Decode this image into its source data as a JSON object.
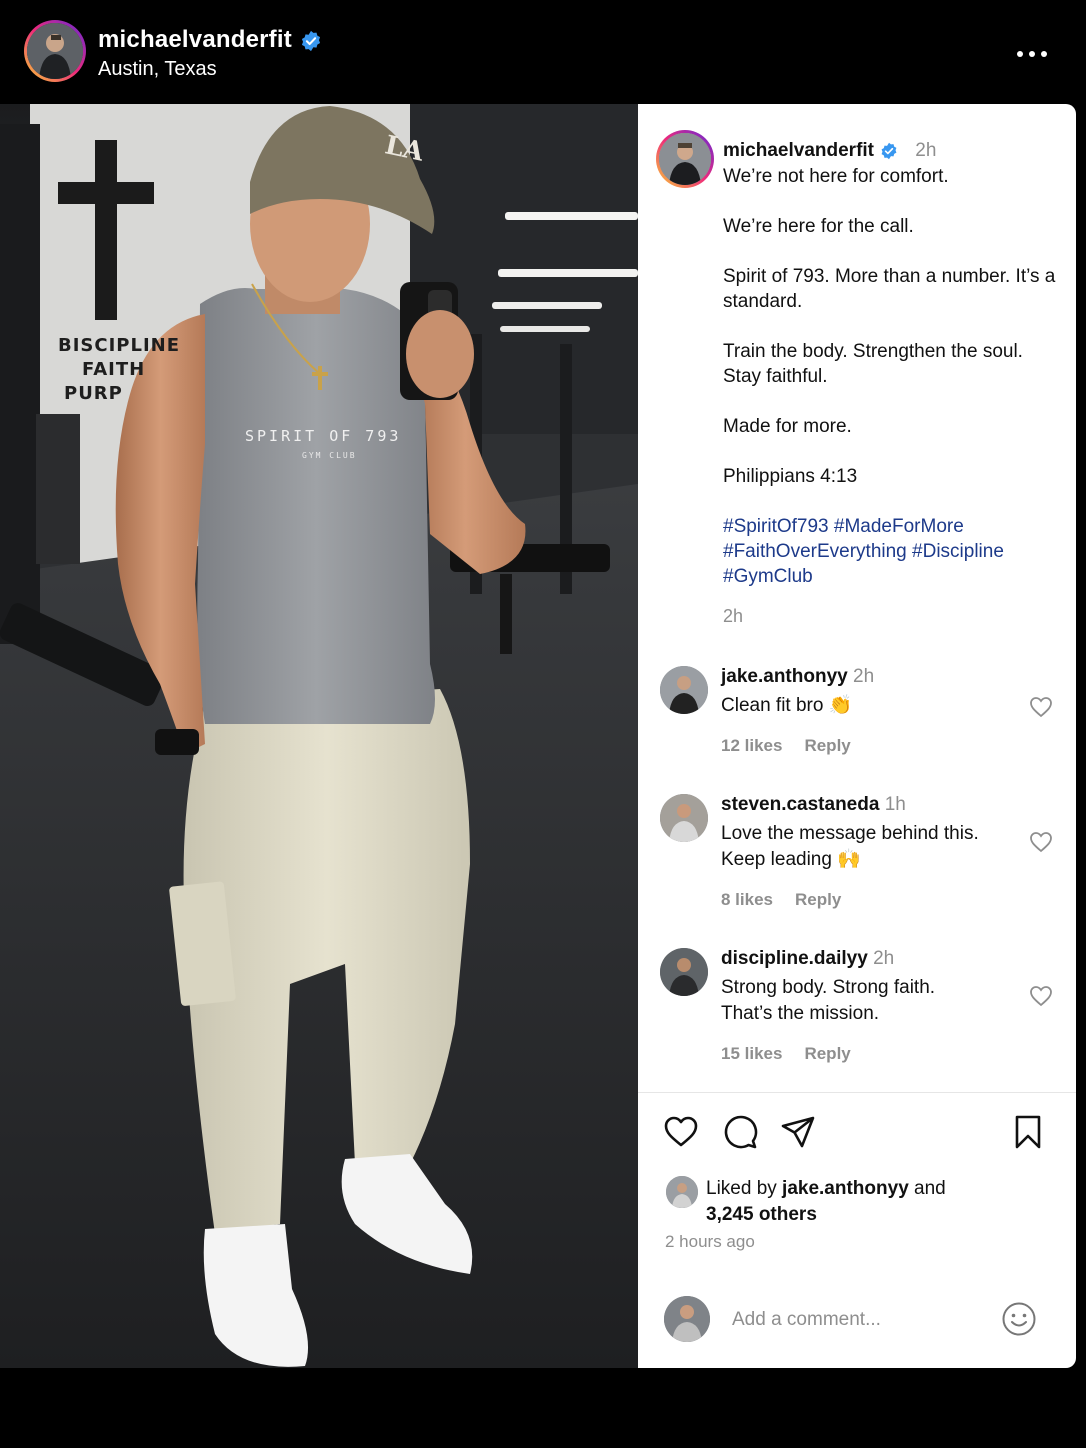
{
  "header": {
    "username": "michaelvanderfit",
    "location": "Austin, Texas",
    "verified_icon": "verified-badge-icon",
    "more_icon": "more-horizontal-icon"
  },
  "post": {
    "image_alt": "Mirror selfie in a gym",
    "wall_text": [
      "BISCIPLINE",
      "FAITH",
      "PURP"
    ],
    "shirt_text": "SPIRIT OF 793",
    "shirt_subtext": "GYM CLUB",
    "cap_logo": "LA"
  },
  "caption": {
    "username": "michaelvanderfit",
    "time": "2h",
    "lines": [
      "We’re not here for comfort.",
      "We’re here for the call.",
      "Spirit of 793. More than a number. It’s a standard.",
      "Train the body. Strengthen the soul. Stay faithful.",
      "Made for more.",
      "Philippians 4:13"
    ],
    "hashtags": "#SpiritOf793 #MadeForMore #FaithOverEverything #Discipline #GymClub",
    "timestamp": "2h"
  },
  "comments": [
    {
      "username": "jake.anthonyy",
      "time": "2h",
      "text": "Clean fit bro 👏",
      "likes": "12 likes",
      "reply": "Reply"
    },
    {
      "username": "steven.castaneda",
      "time": "1h",
      "text": "Love the message behind this. Keep leading 🙌",
      "likes": "8 likes",
      "reply": "Reply"
    },
    {
      "username": "discipline.dailyy",
      "time": "2h",
      "text": "Strong body. Strong faith. That’s the mission.",
      "likes": "15 likes",
      "reply": "Reply"
    }
  ],
  "actions": {
    "icons": [
      "heart-icon",
      "comment-icon",
      "share-icon",
      "bookmark-icon"
    ]
  },
  "likes": {
    "prefix": "Liked by ",
    "user": "jake.anthonyy",
    "middle": " and",
    "others": "3,245 others"
  },
  "posted_ago": "2 hours ago",
  "add_comment": {
    "placeholder": "Add a comment..."
  },
  "colors": {
    "hashtag": "#1d3a8a",
    "verified": "#3897f0",
    "muted": "#8e8e8e"
  }
}
